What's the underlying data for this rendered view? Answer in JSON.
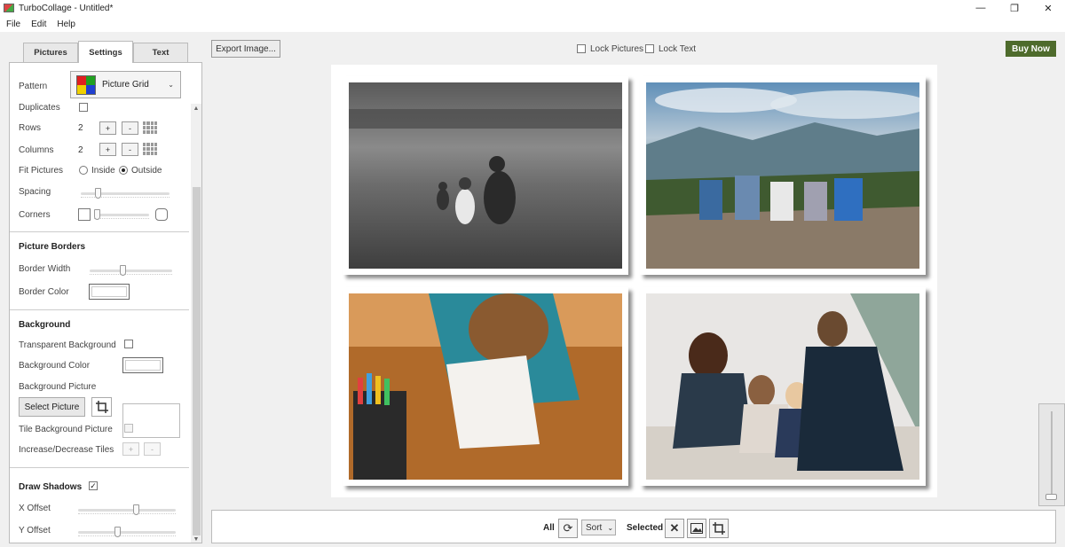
{
  "app": {
    "title": "TurboCollage - Untitled*",
    "window_controls": [
      "—",
      "❐",
      "✕"
    ]
  },
  "menu": [
    "File",
    "Edit",
    "Help"
  ],
  "tabs": [
    "Pictures",
    "Settings",
    "Text"
  ],
  "active_tab": "Settings",
  "settings": {
    "pattern_label": "Pattern",
    "pattern_value": "Picture Grid",
    "duplicates_label": "Duplicates",
    "duplicates_checked": false,
    "rows_label": "Rows",
    "rows_value": "2",
    "columns_label": "Columns",
    "columns_value": "2",
    "fit_label": "Fit Pictures",
    "fit_inside": "Inside",
    "fit_outside": "Outside",
    "fit_selected": "Outside",
    "spacing_label": "Spacing",
    "spacing_level": 0.17,
    "corners_label": "Corners",
    "corners_level": 0.0,
    "plus_symbol": "+",
    "minus_symbol": "-"
  },
  "picture_borders": {
    "heading": "Picture Borders",
    "width_label": "Border Width",
    "width_level": 0.4,
    "color_label": "Border Color",
    "color": "#ffffff"
  },
  "background": {
    "heading": "Background",
    "transparent_label": "Transparent Background",
    "transparent_checked": false,
    "color_label": "Background Color",
    "color": "#ffffff",
    "picture_label": "Background Picture",
    "select_button": "Select Picture",
    "tile_label": "Tile Background Picture",
    "tiles_label": "Increase/Decrease Tiles"
  },
  "shadows": {
    "heading": "Draw Shadows",
    "checked": true,
    "check_mark": "✓",
    "x_label": "X Offset",
    "x_level": 0.6,
    "y_label": "Y Offset",
    "y_level": 0.4
  },
  "toolbar": {
    "export_button": "Export Image...",
    "lock_pictures": "Lock Pictures",
    "lock_text": "Lock Text",
    "buy_button": "Buy Now"
  },
  "bottom_bar": {
    "all_label": "All",
    "sort_label": "Sort",
    "selected_label": "Selected"
  },
  "colors": {
    "buy_button": "#4e6b2c",
    "pattern_swatch": [
      "#e02020",
      "#20a020",
      "#f0d000",
      "#2040d0"
    ]
  },
  "collage": {
    "rows": 2,
    "columns": 2
  }
}
